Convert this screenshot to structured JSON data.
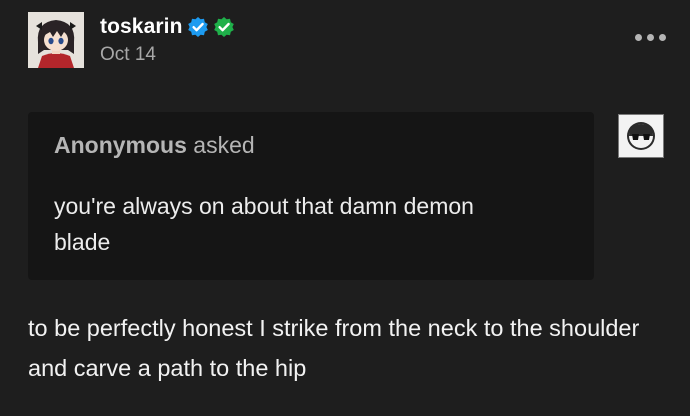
{
  "post": {
    "username": "toskarin",
    "date": "Oct 14",
    "avatar_icon": "anime-girl-avatar-icon",
    "badges": [
      {
        "icon": "blue-verified-check-icon",
        "color": "#1d9bf0"
      },
      {
        "icon": "green-verified-check-icon",
        "color": "#1fb04a"
      }
    ],
    "menu_icon": "more-options-icon"
  },
  "ask": {
    "asker": "Anonymous",
    "verb": "asked",
    "question": "you're always on about that damn demon blade",
    "asker_avatar_icon": "anonymous-sunglasses-icon"
  },
  "answer": {
    "text": "to be perfectly honest I strike from the neck to the shoulder and carve a path to the hip"
  },
  "colors": {
    "background": "#1e1e1e",
    "ask_background": "#151515",
    "muted_text": "#a8a8a8"
  }
}
